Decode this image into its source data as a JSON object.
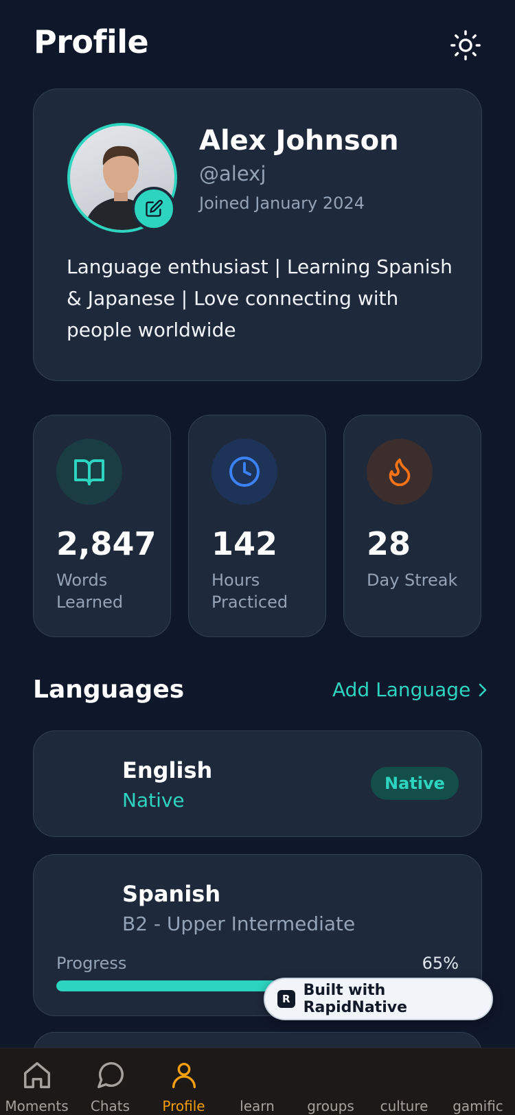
{
  "header": {
    "title": "Profile",
    "theme_icon": "sun-icon"
  },
  "profile": {
    "name": "Alex Johnson",
    "handle": "@alexj",
    "joined": "Joined January 2024",
    "bio": "Language enthusiast | Learning Spanish & Japanese | Love connecting with people worldwide",
    "edit_icon": "edit-icon"
  },
  "stats": [
    {
      "value": "2,847",
      "label": "Words Learned",
      "icon": "book-icon",
      "color": "#2dd4bf"
    },
    {
      "value": "142",
      "label": "Hours Practiced",
      "icon": "clock-icon",
      "color": "#3b82f6"
    },
    {
      "value": "28",
      "label": "Day Streak",
      "icon": "flame-icon",
      "color": "#f97316"
    }
  ],
  "languages": {
    "title": "Languages",
    "add_label": "Add Language",
    "items": [
      {
        "name": "English",
        "level": "Native",
        "badge": "Native"
      },
      {
        "name": "Spanish",
        "level": "B2 - Upper Intermediate",
        "progress_label": "Progress",
        "progress_text": "65%",
        "progress": 0.65
      }
    ]
  },
  "badge": {
    "text": "Built with RapidNative",
    "logo_letter": "R"
  },
  "tabs": [
    {
      "label": "Moments",
      "icon": "home-icon"
    },
    {
      "label": "Chats",
      "icon": "chat-bubble-icon"
    },
    {
      "label": "Profile",
      "icon": "user-icon",
      "active": true
    },
    {
      "label": "learn"
    },
    {
      "label": "groups"
    },
    {
      "label": "culture"
    },
    {
      "label": "gamific"
    }
  ],
  "colors": {
    "accent": "#2dd4bf",
    "active_tab": "#f59e0b",
    "background": "#0f172a",
    "card": "#1e293b"
  }
}
